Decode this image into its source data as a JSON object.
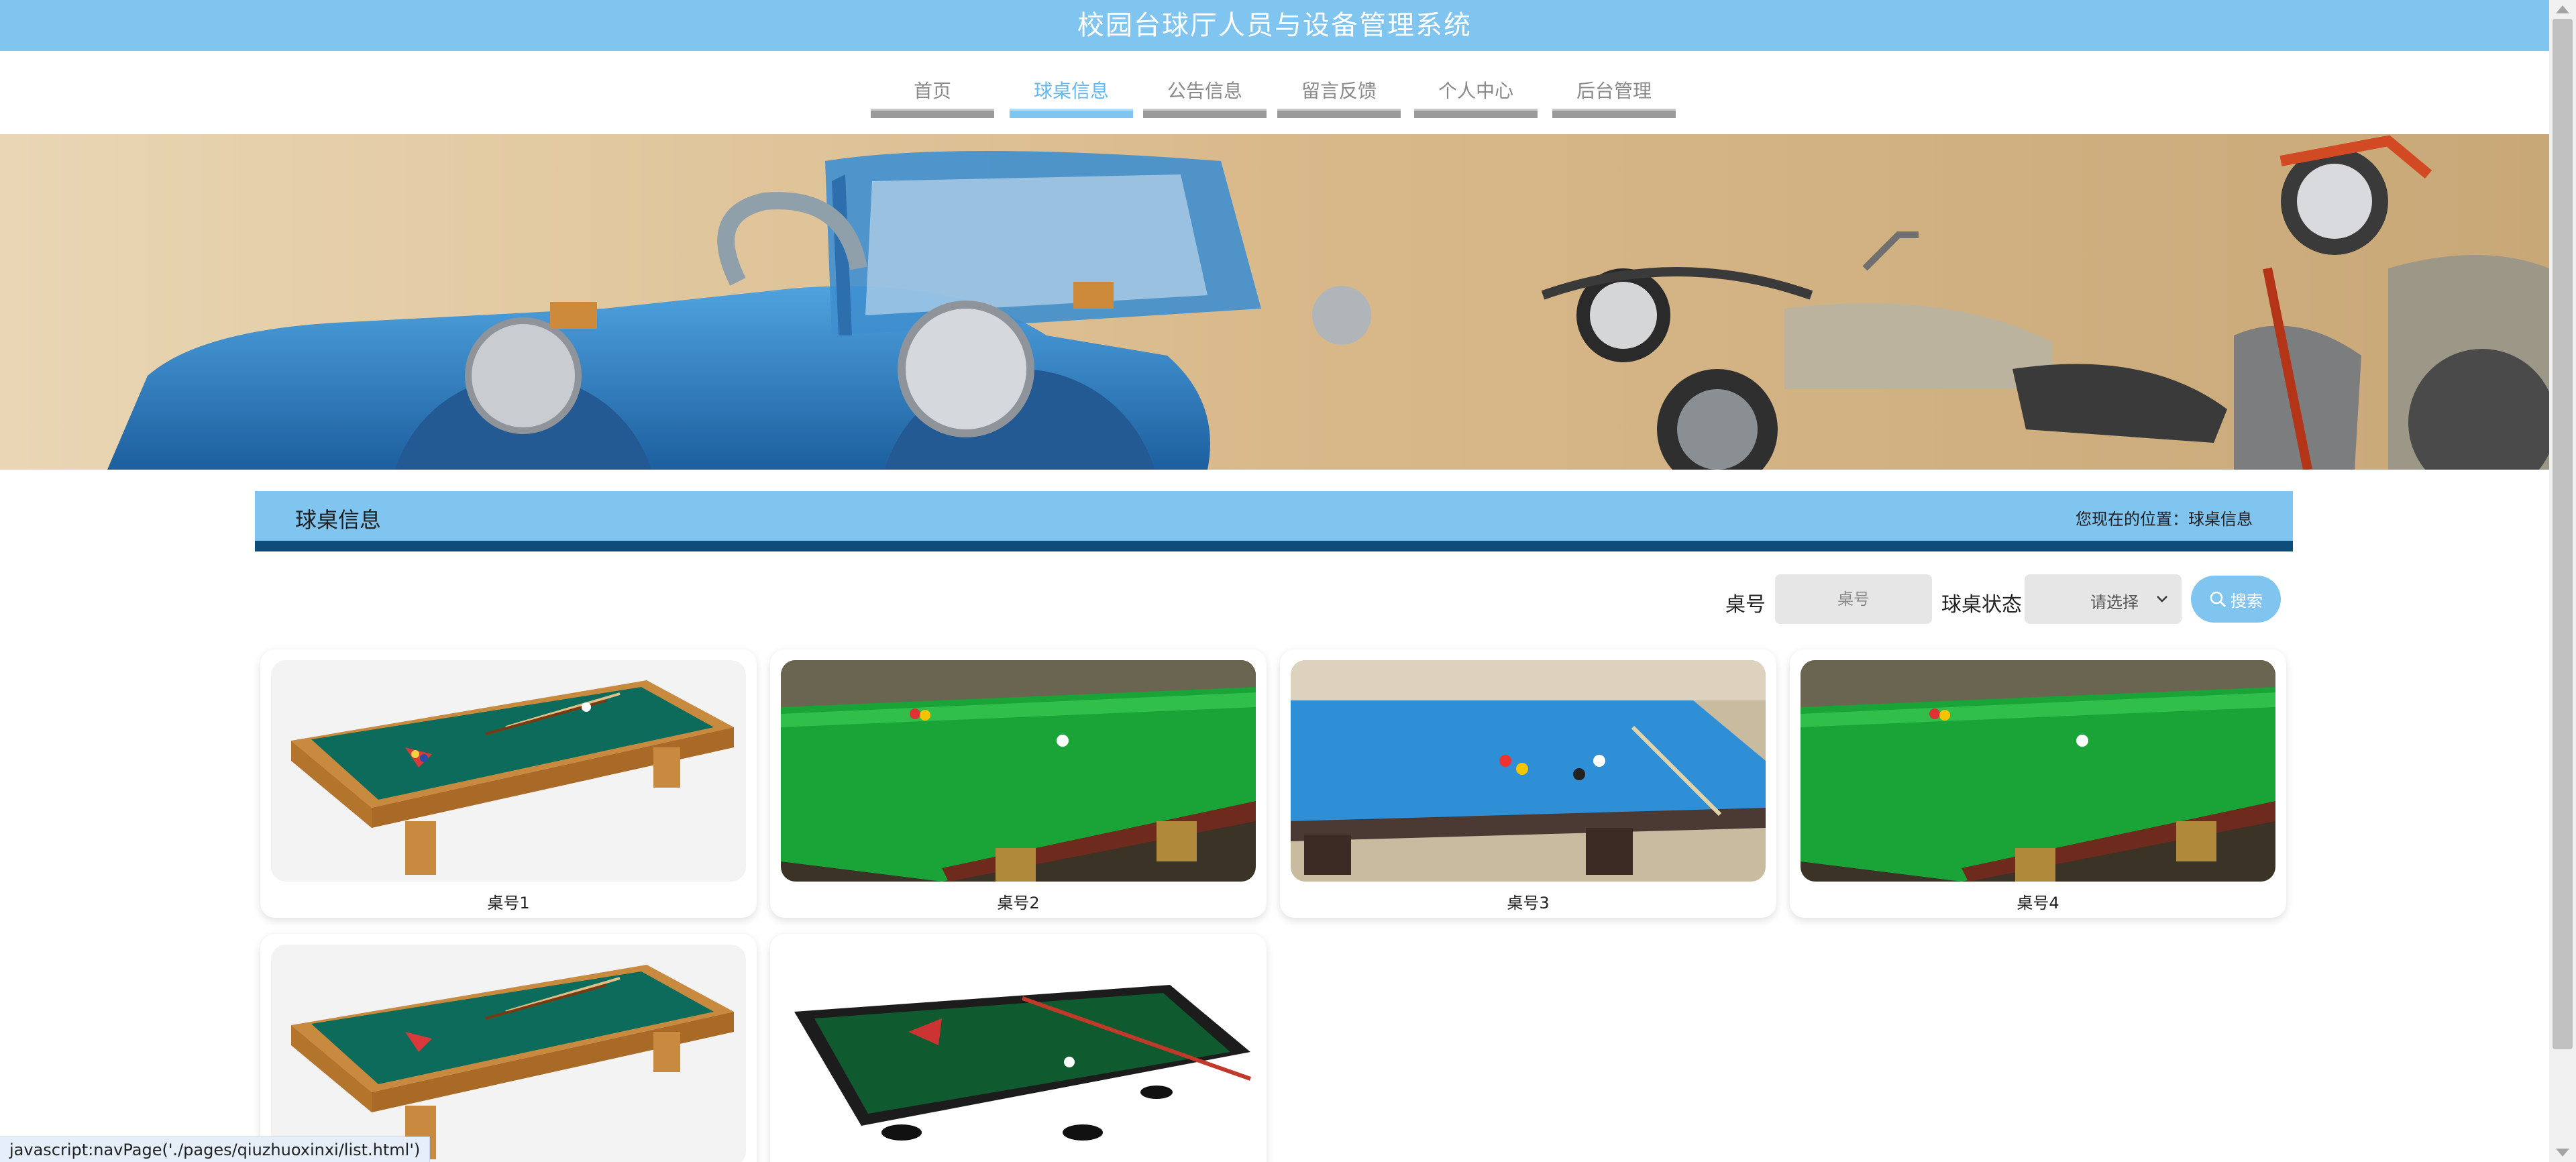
{
  "header": {
    "title": "校园台球厅人员与设备管理系统"
  },
  "nav": {
    "items": [
      {
        "label": "首页",
        "active": false
      },
      {
        "label": "球桌信息",
        "active": true
      },
      {
        "label": "公告信息",
        "active": false
      },
      {
        "label": "留言反馈",
        "active": false
      },
      {
        "label": "个人中心",
        "active": false
      },
      {
        "label": "后台管理",
        "active": false
      }
    ]
  },
  "section": {
    "title": "球桌信息",
    "breadcrumb": "您现在的位置：球桌信息"
  },
  "search": {
    "table_no_label": "桌号",
    "table_no_placeholder": "桌号",
    "status_label": "球桌状态",
    "status_value": "请选择",
    "button_label": "搜索"
  },
  "cards": [
    {
      "name": "桌号1"
    },
    {
      "name": "桌号2"
    },
    {
      "name": "桌号3"
    },
    {
      "name": "桌号4"
    },
    {
      "name": ""
    },
    {
      "name": ""
    }
  ],
  "status_bar": {
    "text": "javascript:navPage('./pages/qiuzhuoxinxi/list.html')"
  },
  "colors": {
    "primary": "#80c4f0",
    "dark_band": "#0e4c7c",
    "nav_bar": "#9a9a9a"
  },
  "icons": {
    "search": "search-icon",
    "dropdown": "chevron-down-icon"
  }
}
